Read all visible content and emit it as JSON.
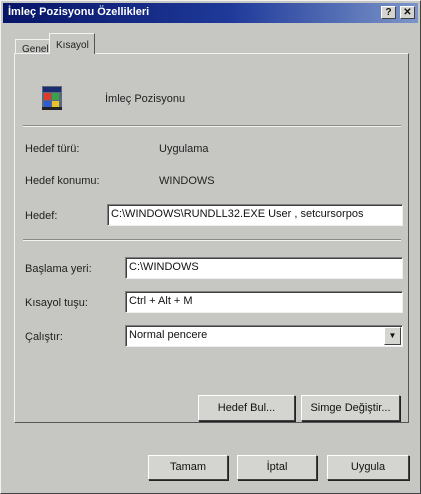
{
  "window": {
    "title": "İmleç Pozisyonu Özellikleri",
    "help_button": "?",
    "close_button": "✕"
  },
  "tabs": [
    {
      "label": "Genel"
    },
    {
      "label": "Kısayol"
    }
  ],
  "shortcut": {
    "name": "İmleç Pozisyonu",
    "icon": "msdos-program-icon",
    "target_type_label": "Hedef türü:",
    "target_type_value": "Uygulama",
    "target_location_label": "Hedef konumu:",
    "target_location_value": "WINDOWS",
    "target_label": "Hedef:",
    "target_value": "C:\\WINDOWS\\RUNDLL32.EXE User , setcursorpos",
    "start_in_label": "Başlama yeri:",
    "start_in_value": "C:\\WINDOWS",
    "shortcut_key_label": "Kısayol tuşu:",
    "shortcut_key_value": "Ctrl + Alt + M",
    "run_label": "Çalıştır:",
    "run_value": "Normal pencere",
    "find_target_button": "Hedef Bul...",
    "change_icon_button": "Simge Değiştir..."
  },
  "footer": {
    "ok_button": "Tamam",
    "cancel_button": "İptal",
    "apply_button": "Uygula"
  }
}
